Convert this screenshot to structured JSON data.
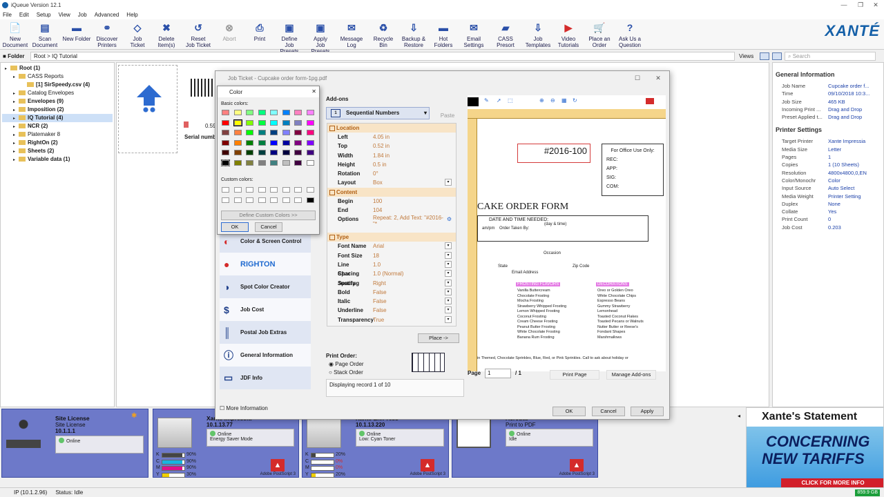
{
  "app": {
    "title": "iQueue Version 12.1"
  },
  "menu": [
    "File",
    "Edit",
    "Setup",
    "View",
    "Job",
    "Advanced",
    "Help"
  ],
  "toolbar": [
    {
      "label": "New\nDocument",
      "icon": "new-document-icon"
    },
    {
      "label": "Scan\nDocument",
      "icon": "scan-icon"
    },
    {
      "label": "New Folder",
      "icon": "new-folder-icon"
    },
    {
      "label": "Discover\nPrinters",
      "icon": "discover-icon"
    },
    {
      "label": "Job\nTicket",
      "icon": "job-ticket-icon"
    },
    {
      "label": "Delete\nItem(s)",
      "icon": "delete-icon"
    },
    {
      "label": "Reset\nJob Ticket",
      "icon": "reset-icon"
    },
    {
      "label": "Abort",
      "icon": "abort-icon"
    },
    {
      "label": "Print",
      "icon": "print-icon"
    },
    {
      "label": "Define\nJob Presets",
      "icon": "define-presets-icon"
    },
    {
      "label": "Apply\nJob Presets",
      "icon": "apply-presets-icon"
    },
    {
      "label": "Message\nLog",
      "icon": "message-log-icon"
    },
    {
      "label": "Recycle\nBin",
      "icon": "recycle-icon"
    },
    {
      "label": "Backup &\nRestore",
      "icon": "backup-icon"
    },
    {
      "label": "Hot\nFolders",
      "icon": "hot-folders-icon"
    },
    {
      "label": "Email\nSettings",
      "icon": "email-icon"
    },
    {
      "label": "CASS\nPresort",
      "icon": "cass-icon"
    },
    {
      "label": "Job\nTemplates",
      "icon": "job-templates-icon"
    },
    {
      "label": "Video\nTutorials",
      "icon": "video-icon"
    },
    {
      "label": "Place an\nOrder",
      "icon": "order-icon"
    },
    {
      "label": "Ask Us a\nQuestion",
      "icon": "question-icon"
    }
  ],
  "brand": "XANTÉ",
  "address": {
    "label": "Folder",
    "path": "Root > IQ Tutorial",
    "views": "Views",
    "search_placeholder": "Search"
  },
  "tree": [
    {
      "label": "Root (1)",
      "indent": 0
    },
    {
      "label": "CASS Reports",
      "indent": 1
    },
    {
      "label": "[1] SirSpeedy.csv (4)",
      "indent": 2
    },
    {
      "label": "Catalog Envelopes",
      "indent": 1
    },
    {
      "label": "Envelopes (9)",
      "indent": 1
    },
    {
      "label": "Imposition (2)",
      "indent": 1
    },
    {
      "label": "IQ Tutorial (4)",
      "indent": 1,
      "selected": true
    },
    {
      "label": "NCR (2)",
      "indent": 1
    },
    {
      "label": "Platemaker 8",
      "indent": 1
    },
    {
      "label": "RightOn (2)",
      "indent": 1
    },
    {
      "label": "Sheets (2)",
      "indent": 1
    },
    {
      "label": "Variable data (1)",
      "indent": 1
    }
  ],
  "thumbs": {
    "t1_count": "0.59",
    "t1_name": "Serial numb"
  },
  "general_info": {
    "title": "General Information",
    "rows": [
      [
        "Job Name",
        "Cupcake order f..."
      ],
      [
        "Time",
        "09/10/2018 10:3..."
      ],
      [
        "Job Size",
        "465 KB"
      ],
      [
        "Incoming Print ...",
        "Drag and Drop"
      ],
      [
        "Preset Applied t...",
        "Drag and Drop"
      ]
    ]
  },
  "printer_settings": {
    "title": "Printer Settings",
    "rows": [
      [
        "Target Printer",
        "Xante Impressia"
      ],
      [
        "Media Size",
        "Letter"
      ],
      [
        "Pages",
        "1"
      ],
      [
        "Copies",
        "1 (10 Sheets)"
      ],
      [
        "Resolution",
        "4800x4800,0,EN"
      ],
      [
        "Color/Monochr",
        "Color"
      ],
      [
        "Input Source",
        "Auto Select"
      ],
      [
        "Media Weight",
        "Printer Setting"
      ],
      [
        "Duplex",
        "None"
      ],
      [
        "Collate",
        "Yes"
      ],
      [
        "Print Count",
        "0"
      ],
      [
        "Job Cost",
        "0.203"
      ]
    ]
  },
  "job_ticket": {
    "title": "Job Ticket - Cupcake order form-1pg.pdf",
    "addons_label": "Add-ons",
    "addon_selected": "Sequential Numbers",
    "paste": "Paste",
    "sections": {
      "location": "Location",
      "content": "Content",
      "type": "Type"
    },
    "location": [
      [
        "Left",
        "4.05 in"
      ],
      [
        "Top",
        "0.52 in"
      ],
      [
        "Width",
        "1.84 in"
      ],
      [
        "Height",
        "0.5 in"
      ],
      [
        "Rotation",
        "0°"
      ],
      [
        "Layout Shape",
        "Box"
      ]
    ],
    "content": [
      [
        "Begin",
        "100"
      ],
      [
        "End",
        "104"
      ],
      [
        "Options",
        "Repeat: 2, Add Text: \"#2016-\"*"
      ]
    ],
    "type": [
      [
        "Font Name",
        "Arial"
      ],
      [
        "Font Size",
        "18"
      ],
      [
        "Line Spacing",
        "1.0"
      ],
      [
        "Char Spacing",
        "1.0 (Normal)"
      ],
      [
        "Justify",
        "Right"
      ],
      [
        "Bold",
        "False"
      ],
      [
        "Italic",
        "False"
      ],
      [
        "Underline",
        "False"
      ],
      [
        "Transparency",
        "True"
      ]
    ],
    "place": "Place ->",
    "print_order": "Print Order:",
    "page_order": "Page Order",
    "stack_order": "Stack Order",
    "display": "Displaying record 1 of 10",
    "left_items": [
      "Color & Screen Control",
      "RIGHTON",
      "Spot Color Creator",
      "Job Cost",
      "Postal Job Extras",
      "General Information",
      "JDF Info"
    ],
    "more_info": "More Information",
    "page_label": "Page",
    "page_value": "1",
    "page_total": "/ 1",
    "print_page": "Print Page",
    "manage_addons": "Manage Add-ons",
    "ok": "OK",
    "cancel": "Cancel",
    "apply": "Apply",
    "preview": {
      "number": "#2016-100",
      "office": "For Office Use Only:",
      "rec": "REC:",
      "app": "APP:",
      "sig": "SIG:",
      "com": "COM:",
      "heading": "CAKE ORDER FORM",
      "dt": "DATE AND TIME NEEDED:",
      "dt2": "(day & time)",
      "order_taken": "Order Taken By:",
      "ampm": "am/pm",
      "occasion": "Occasion",
      "state": "State",
      "zip": "Zip Code",
      "email": "Email Address",
      "frost": "FROSTING FLAVORS",
      "deco": "DECORATIONS",
      "frostings": [
        "Vanilla Buttercream",
        "Chocolate Frosting",
        "Mocha Frosting",
        "Strawberry Whipped Frosting",
        "Lemon Whipped Frosting",
        "Coconut Frosting",
        "Cream Cheese Frosting",
        "Peanut Butter Frosting",
        "White Chocolate Frosting",
        "Banana Rum Frosting"
      ],
      "decos": [
        "Oreo or Golden Oreo",
        "White Chocolate Chips",
        "Espresso Beans",
        "Gummy Strawberry",
        "Lemonhead",
        "Toasted Coconut Flakes",
        "Toasted Pecans or Walnuts",
        "Nutter Butter or Reese's",
        "Fondant Shapes",
        "Marshmallows"
      ],
      "footer": "in Themed, Chocolate Sprinkles, Blue, Red, or Pink Sprinkles. Call to ask about holiday or"
    }
  },
  "color_dialog": {
    "title": "Color",
    "basic": "Basic colors:",
    "custom": "Custom colors:",
    "define": "Define Custom Colors >>",
    "ok": "OK",
    "cancel": "Cancel",
    "colors": [
      "#ff8080",
      "#ffff80",
      "#80ff80",
      "#00ff80",
      "#80ffff",
      "#0080ff",
      "#ff80c0",
      "#ff80ff",
      "#ff0000",
      "#ffff00",
      "#80ff00",
      "#00ff40",
      "#00ffff",
      "#0080c0",
      "#8080c0",
      "#ff00ff",
      "#804040",
      "#ff8040",
      "#00ff00",
      "#008080",
      "#004080",
      "#8080ff",
      "#800040",
      "#ff0080",
      "#800000",
      "#ff8000",
      "#008000",
      "#008040",
      "#0000ff",
      "#0000a0",
      "#800080",
      "#8000ff",
      "#400000",
      "#804000",
      "#004000",
      "#004040",
      "#000080",
      "#000040",
      "#400040",
      "#400080",
      "#000000",
      "#808000",
      "#808040",
      "#808080",
      "#408080",
      "#c0c0c0",
      "#400040",
      "#ffffff"
    ]
  },
  "devices": [
    {
      "name": "Site License",
      "sub": "Site License",
      "ip": "10.1.1.1",
      "status": "Online",
      "note": ""
    },
    {
      "name": "Xante Impressia",
      "sub": "",
      "ip": "10.1.13.77",
      "status": "Online",
      "note": "Energy Saver Mode",
      "levels": [
        "90%",
        "90%",
        "90%",
        "30%"
      ],
      "ps": "Adobe PostScript 3"
    },
    {
      "name": "Xante En/Press",
      "sub": "",
      "ip": "10.1.13.220",
      "status": "Online",
      "note": "Low: Cyan Toner",
      "levels": [
        "20%",
        "0%",
        "0%",
        "20%"
      ],
      "ps": "Adobe PostScript 3"
    },
    {
      "name": "Acrobat",
      "sub": "Print to PDF",
      "ip": "",
      "status": "Online",
      "note": "Idle",
      "ps": "Adobe PostScript 3"
    }
  ],
  "ad": {
    "title": "Xante's Statement",
    "line1": "CONCERNING",
    "line2": "NEW TARIFFS",
    "cta": "CLICK FOR MORE INFO"
  },
  "statusbar": {
    "ip": "IP (10.1.2.96)",
    "status": "Status: Idle",
    "disk": "859.9 GB"
  }
}
